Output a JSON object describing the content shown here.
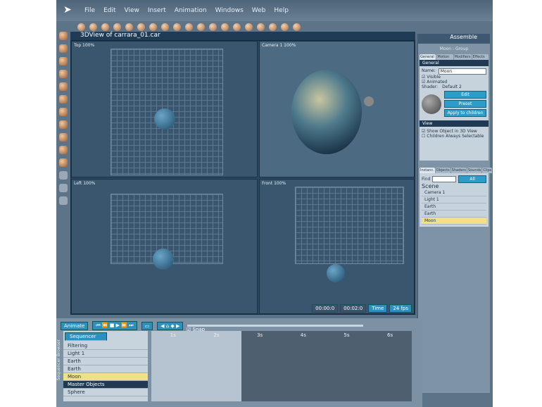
{
  "menu": [
    "File",
    "Edit",
    "View",
    "Insert",
    "Animation",
    "Windows",
    "Web",
    "Help"
  ],
  "view_title": "3DView of carrara_01.car",
  "viewports": [
    "Top 100%",
    "Camera 1 100%",
    "Left 100%",
    "Front 100%"
  ],
  "time": {
    "current": "00:00:0",
    "total": "00:02:0",
    "time_label": "Time",
    "fps": "24 fps"
  },
  "panel": {
    "title": "Assemble",
    "subtitle": "Moon : Group",
    "tabs": [
      "General",
      "Motion",
      "Modifiers",
      "Effects"
    ],
    "section_general": "General",
    "name_label": "Name:",
    "name_value": "Moon",
    "visible": "Visible",
    "animated": "Animated",
    "shader_label": "Shader:",
    "shader_value": "Default 2",
    "buttons": [
      "Edit",
      "Preset",
      "Apply to children"
    ],
    "section_view": "View",
    "show_obj": "Show Object in 3D View",
    "children_sel": "Children Always Selectable"
  },
  "browser": {
    "tabs": [
      "Instanc.",
      "Objects",
      "Shaders",
      "Sounds",
      "Clips"
    ],
    "find_label": "Find",
    "find_value": "",
    "filter_value": "All",
    "scene_label": "Scene",
    "items": [
      "Camera 1",
      "Light 1",
      "Earth",
      "Earth",
      "Moon"
    ]
  },
  "timeline": {
    "animate": "Animate",
    "snap": "Snap",
    "sequencer_select": "Sequencer",
    "filtering": "Filtering",
    "side_tabs": [
      "Sequencer",
      "Browser"
    ],
    "items": [
      "Light 1",
      "Earth",
      "Earth",
      "Moon"
    ],
    "master": "Master Objects",
    "master_items": [
      "Sphere"
    ],
    "ticks": [
      "1s",
      "2s",
      "3s",
      "4s",
      "5s",
      "6s"
    ]
  }
}
